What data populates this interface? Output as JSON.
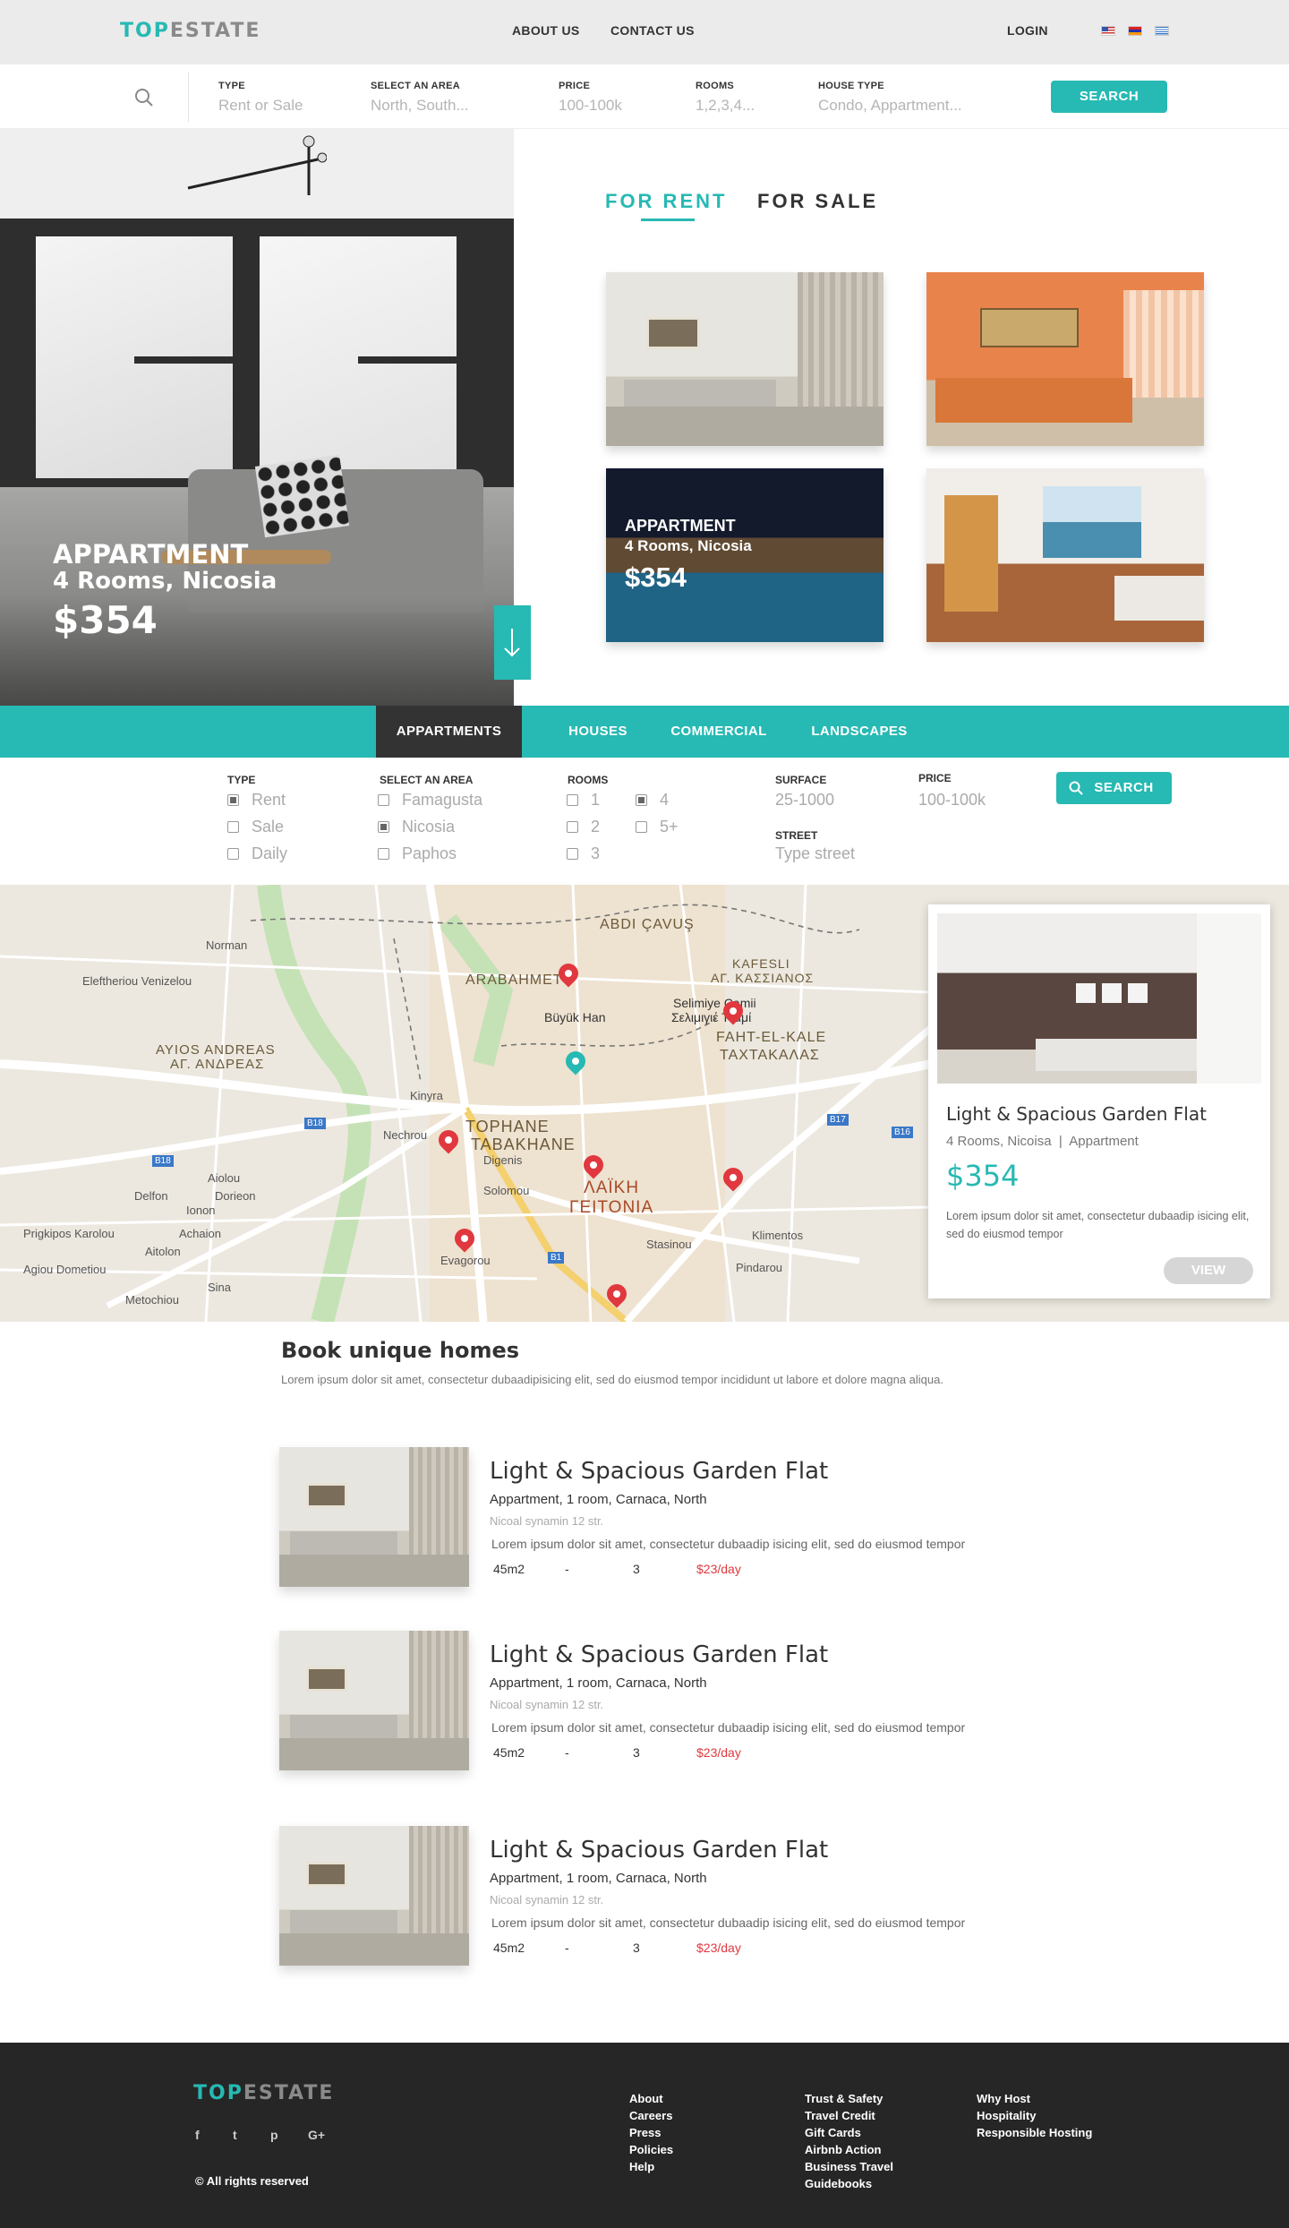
{
  "brand": {
    "logo_a": "TOP",
    "logo_b": "ESTATE"
  },
  "header": {
    "about": "ABOUT US",
    "contact": "CONTACT US",
    "login": "LOGIN"
  },
  "search": {
    "type_label": "TYPE",
    "type_val": "Rent or Sale",
    "area_label": "SELECT AN AREA",
    "area_val": "North, South...",
    "price_label": "PRICE",
    "price_val": "100-100k",
    "rooms_label": "ROOMS",
    "rooms_val": "1,2,3,4...",
    "house_label": "HOUSE TYPE",
    "house_val": "Condo, Appartment...",
    "button": "SEARCH"
  },
  "hero": {
    "title": "APPARTMENT",
    "subtitle": "4 Rooms, Nicosia",
    "price": "$354"
  },
  "tabs": {
    "rent": "FOR RENT",
    "sale": "FOR SALE"
  },
  "featured_overlay": {
    "title": "APPARTMENT",
    "subtitle": "4 Rooms, Nicosia",
    "price": "$354"
  },
  "categories": [
    "APPARTMENTS",
    "HOUSES",
    "COMMERCIAL",
    "LANDSCAPES"
  ],
  "filters": {
    "type_label": "TYPE",
    "type_opts": [
      "Rent",
      "Sale",
      "Daily"
    ],
    "area_label": "SELECT AN AREA",
    "area_opts": [
      "Famagusta",
      "Nicosia",
      "Paphos"
    ],
    "rooms_label": "ROOMS",
    "rooms_opts": [
      "1",
      "2",
      "3",
      "4",
      "5+"
    ],
    "surface_label": "SURFACE",
    "surface_val": "25-1000",
    "price_label": "PRICE",
    "price_val": "100-100k",
    "street_label": "STREET",
    "street_val": "Type street",
    "button": "SEARCH"
  },
  "map": {
    "labels": [
      "ABDI ÇAVUŞ",
      "ARABAHMET",
      "KAFESLI",
      "ΑΓ. ΚΑΣΣΙΑΝΟΣ",
      "Büyük Han",
      "Selimiye Camii",
      "Σελιμιγιέ Τζαμί",
      "FAHT-EL-KALE",
      "ΤΑΧΤΑΚΑΛΑΣ",
      "AYIOS ANDREAS",
      "ΑΓ. ΑΝΔΡΕΑΣ",
      "TOPHANE",
      "TABAKHANE",
      "ΛΑΪΚΗ",
      "ΓΕΙΤΟΝΙΑ",
      "Norman",
      "Eleftheriou Venizelou",
      "Kinyra",
      "Nechrou",
      "Stasinou",
      "Evagorou",
      "Solomou",
      "Pindarou",
      "Klimentos",
      "Ionon",
      "Aitolon",
      "Dorieon",
      "Achaion",
      "Prigkipos Karolou",
      "Agiou Dometiou",
      "Sina",
      "Metochiou",
      "Delfon",
      "Aiolou",
      "Digenis",
      "B18",
      "B17",
      "B16",
      "B1"
    ]
  },
  "map_card": {
    "title": "Light & Spacious Garden Flat",
    "meta": "4 Rooms, Nicoisa  |  Appartment",
    "price": "$354",
    "desc": "Lorem ipsum dolor sit amet, consectetur  dubaadip isicing elit, sed do eiusmod tempor",
    "button": "VIEW"
  },
  "book": {
    "title": "Book unique homes",
    "desc": "Lorem ipsum dolor sit amet, consectetur  dubaadipisicing elit, sed do eiusmod tempor incididunt ut labore et dolore magna aliqua."
  },
  "listings": [
    {
      "title": "Light & Spacious Garden Flat",
      "sub": "Appartment, 1 room, Carnaca, North",
      "addr": "Nicoal synamin 12 str.",
      "desc": "Lorem ipsum dolor sit amet, consectetur  dubaadip isicing elit, sed do eiusmod tempor",
      "area": "45m2",
      "dash": "-",
      "rooms": "3",
      "price": "$23/day"
    },
    {
      "title": "Light & Spacious Garden Flat",
      "sub": "Appartment, 1 room, Carnaca, North",
      "addr": "Nicoal synamin 12 str.",
      "desc": "Lorem ipsum dolor sit amet, consectetur  dubaadip isicing elit, sed do eiusmod tempor",
      "area": "45m2",
      "dash": "-",
      "rooms": "3",
      "price": "$23/day"
    },
    {
      "title": "Light & Spacious Garden Flat",
      "sub": "Appartment, 1 room, Carnaca, North",
      "addr": "Nicoal synamin 12 str.",
      "desc": "Lorem ipsum dolor sit amet, consectetur  dubaadip isicing elit, sed do eiusmod tempor",
      "area": "45m2",
      "dash": "-",
      "rooms": "3",
      "price": "$23/day"
    }
  ],
  "footer": {
    "col1": [
      "About",
      "Careers",
      "Press",
      "Policies",
      "Help"
    ],
    "col2": [
      "Trust & Safety",
      "Travel Credit",
      "Gift Cards",
      "Airbnb Action",
      "Business Travel",
      "Guidebooks"
    ],
    "col3": [
      "Why Host",
      "Hospitality",
      "Responsible Hosting"
    ],
    "social": [
      "f",
      "t",
      "p",
      "G+"
    ],
    "copyright": "© All rights reserved"
  },
  "colors": {
    "accent": "#27b9b3",
    "dark": "#262626",
    "price_red": "#e0383e"
  }
}
